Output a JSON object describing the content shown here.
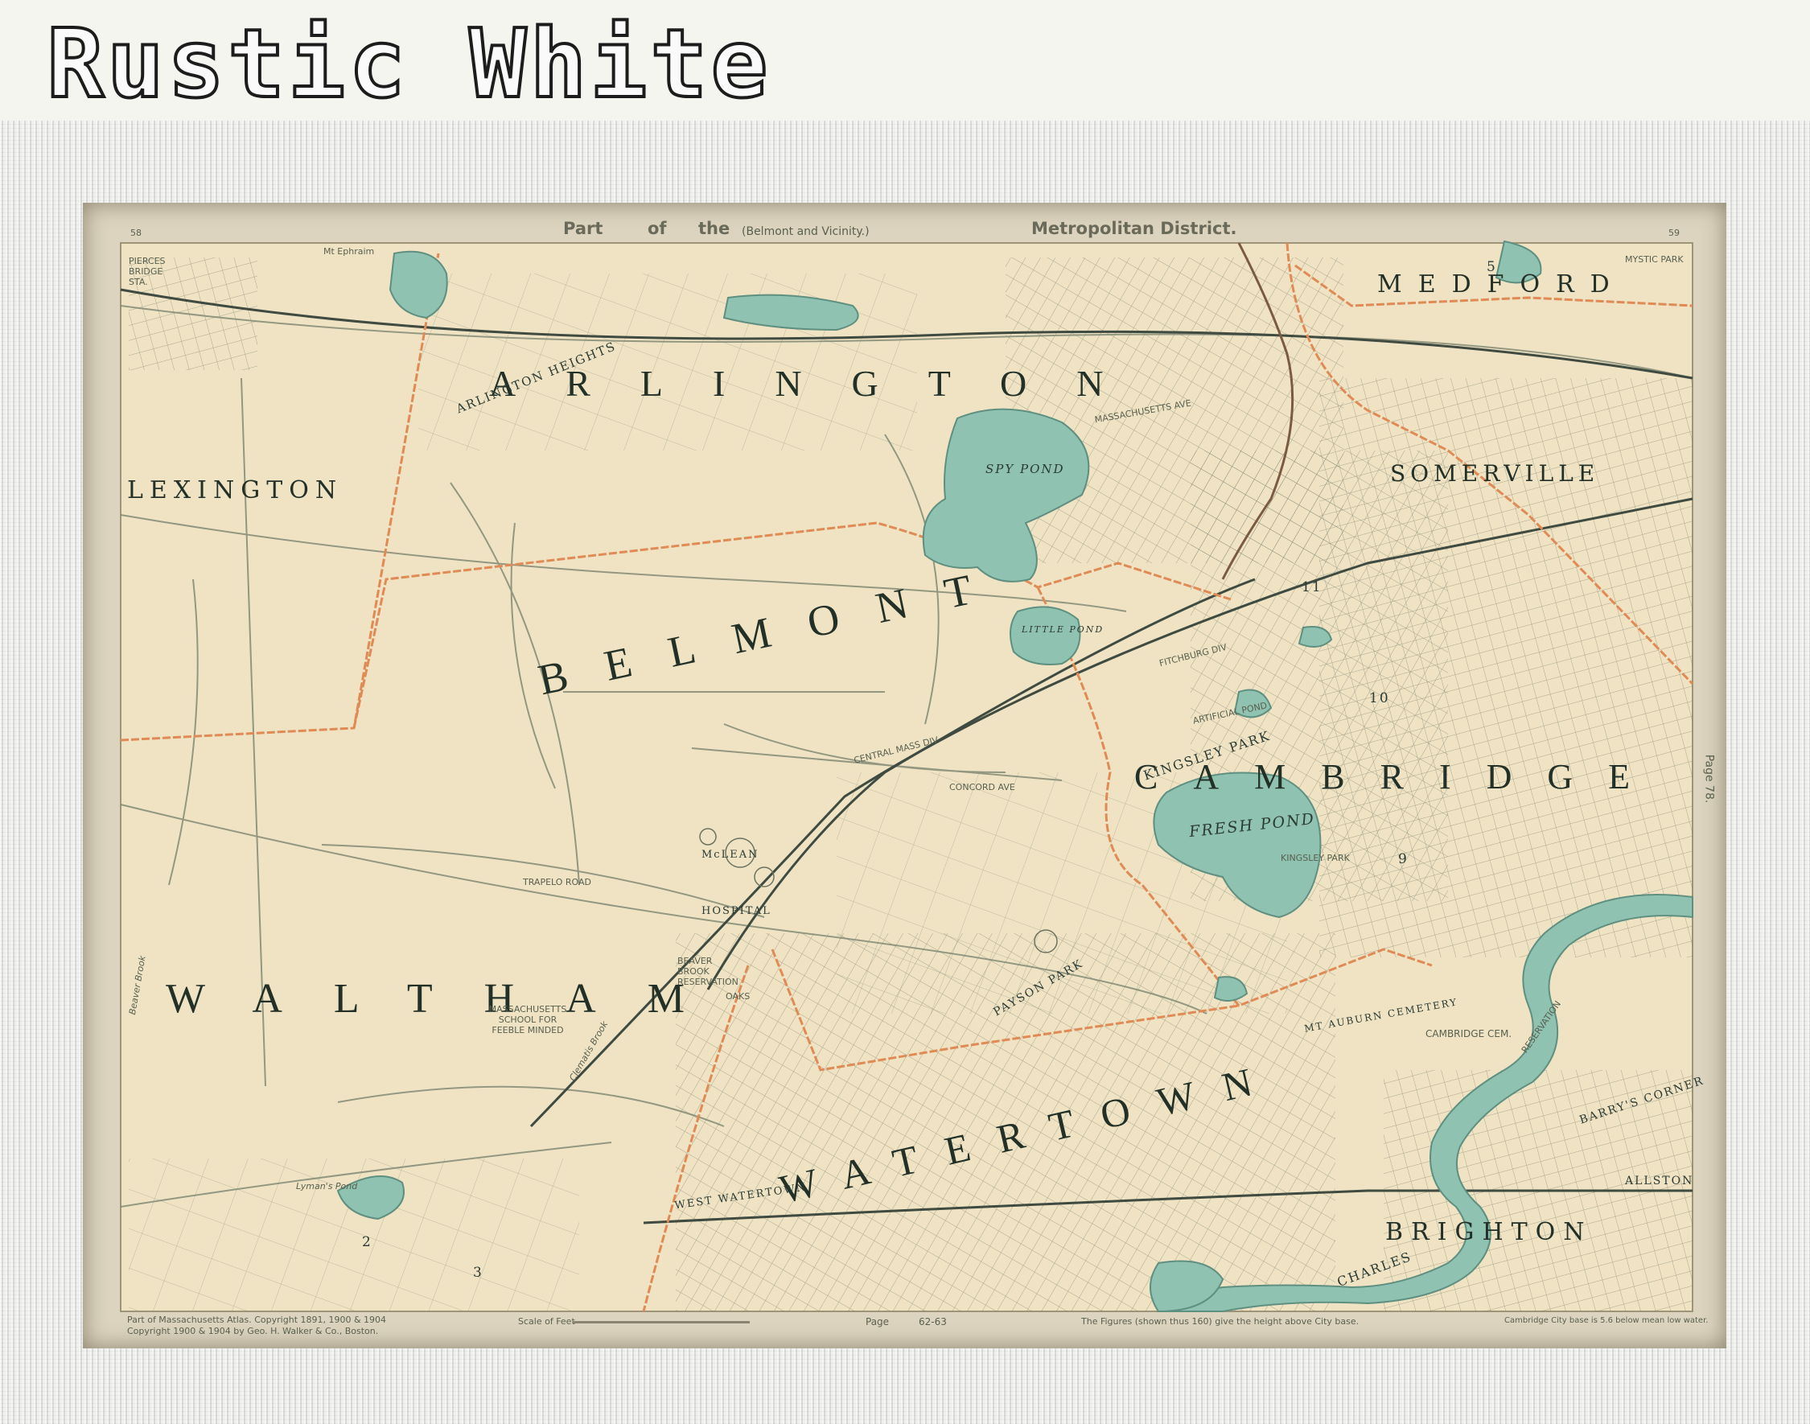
{
  "banner": {
    "title": "Rustic White"
  },
  "map": {
    "header": {
      "part": "Part",
      "of": "of",
      "the": "the",
      "subtitle": "(Belmont and Vicinity.)",
      "district": "Metropolitan District.",
      "left_page": "58",
      "right_page": "59",
      "side_note": "Page 78."
    },
    "towns": {
      "arlington": "ARLINGTON",
      "lexington": "LEXINGTON",
      "belmont": "BELMONT",
      "waltham": "WALTHAM",
      "watertown": "WATERTOWN",
      "cambridge": "CAMBRIDGE",
      "somerville": "SOMERVILLE",
      "medford": "MEDFORD",
      "brighton": "BRIGHTON"
    },
    "places": {
      "arlington_heights": "ARLINGTON HEIGHTS",
      "spy_pond": "SPY POND",
      "little_pond": "LITTLE POND",
      "fresh_pond": "FRESH POND",
      "kingsley_park": "KINGSLEY PARK",
      "kingsley_park_small": "KINGSLEY PARK",
      "mclean_hospital": "McLEAN HOSPITAL",
      "west_watertown": "WEST WATERTOWN",
      "mt_auburn_cemetery": "MT AUBURN CEMETERY",
      "cambridge_cem": "CAMBRIDGE CEM.",
      "barrys_corner": "BARRY'S CORNER",
      "allston": "ALLSTON",
      "mystic_park": "MYSTIC PARK",
      "mt_ephraim": "Mt Ephraim",
      "beaver_brook_reservation": "BEAVER BROOK RESERVATION",
      "oaks": "OAKS",
      "feeble_minded": "MASSACHUSETTS SCHOOL FOR FEEBLE MINDED",
      "payson_park": "PAYSON PARK",
      "charles_river": "CHARLES",
      "lymans_pond": "Lyman's Pond",
      "beaver_brook": "Beaver Brook",
      "artificial_pond": "ARTIFICIAL POND",
      "reservation": "RESERVATION",
      "pierces_bridge": "PIERCES BRIDGE STA.",
      "clematis_brook": "Clematis Brook",
      "central_mass_div": "CENTRAL MASS DIV",
      "fitchburg_div": "FITCHBURG DIV",
      "concord_ave": "CONCORD AVE",
      "trapelo_road": "TRAPELO ROAD",
      "mass_ave": "MASSACHUSETTS AVE",
      "ward_2": "2",
      "ward_3": "3",
      "ward_5": "5",
      "ward_9": "9",
      "ward_10": "10",
      "ward_11": "11"
    },
    "footer": {
      "left_line1": "Part of Massachusetts Atlas. Copyright 1891, 1900 & 1904",
      "left_line2": "Copyright 1900 & 1904 by Geo. H. Walker & Co., Boston.",
      "scale": "Scale of Feet",
      "page_label": "Page",
      "page_number": "62-63",
      "elevation_note": "The Figures (shown thus 160) give the height above City base.",
      "datum_note": "Cambridge City base is 5.6 below mean low water."
    },
    "colors": {
      "paper": "#efe3c4",
      "water": "#8fc2b0",
      "boundary": "#e08a55",
      "ink": "#4a5a4d",
      "frame": "#e9e9e6"
    }
  }
}
